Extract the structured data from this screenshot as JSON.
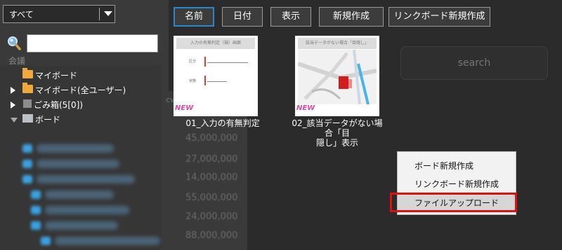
{
  "filter_dropdown": {
    "selected": "すべて"
  },
  "search": {
    "placeholder": "",
    "right_placeholder": "search"
  },
  "tree": {
    "header": "会議",
    "items": [
      {
        "label": "マイボード"
      },
      {
        "label": "マイボード(全ユーザー)"
      },
      {
        "label": "ごみ箱(5[0])"
      },
      {
        "label": "ボード"
      }
    ]
  },
  "toolbar": {
    "buttons": [
      {
        "label": "名前"
      },
      {
        "label": "日付"
      },
      {
        "label": "表示"
      },
      {
        "label": "新規作成"
      },
      {
        "label": "リンクボード新規作成"
      }
    ]
  },
  "column_header": "cv",
  "background_numbers": [
    "45,000,000",
    "27,000,000",
    "14,000,000",
    "55,000,000",
    "24,000,000",
    "88,000,000"
  ],
  "thumbnails": [
    {
      "title_line1": "01_入力の有無判定",
      "title_line2": "",
      "inner_title": "入力の有無判定（規）画面",
      "badge": "NEW",
      "field_labels": [
        "区分",
        "状態"
      ]
    },
    {
      "title_line1": "02_該当データがない場合「目",
      "title_line2": "隠し」表示",
      "inner_title": "該当データがない場合「目隠し」",
      "badge": "NEW"
    }
  ],
  "context_menu": {
    "items": [
      {
        "label": "ボード新規作成"
      },
      {
        "label": "リンクボード新規作成"
      },
      {
        "label": "ファイルアップロード"
      }
    ],
    "highlighted_index": 2
  },
  "colors": {
    "background": "#2b2b2b",
    "active_tab_border": "#2e86c8",
    "highlight_box": "#e01010",
    "folder": "#f2a93b",
    "new_badge": "#d44aa8"
  }
}
